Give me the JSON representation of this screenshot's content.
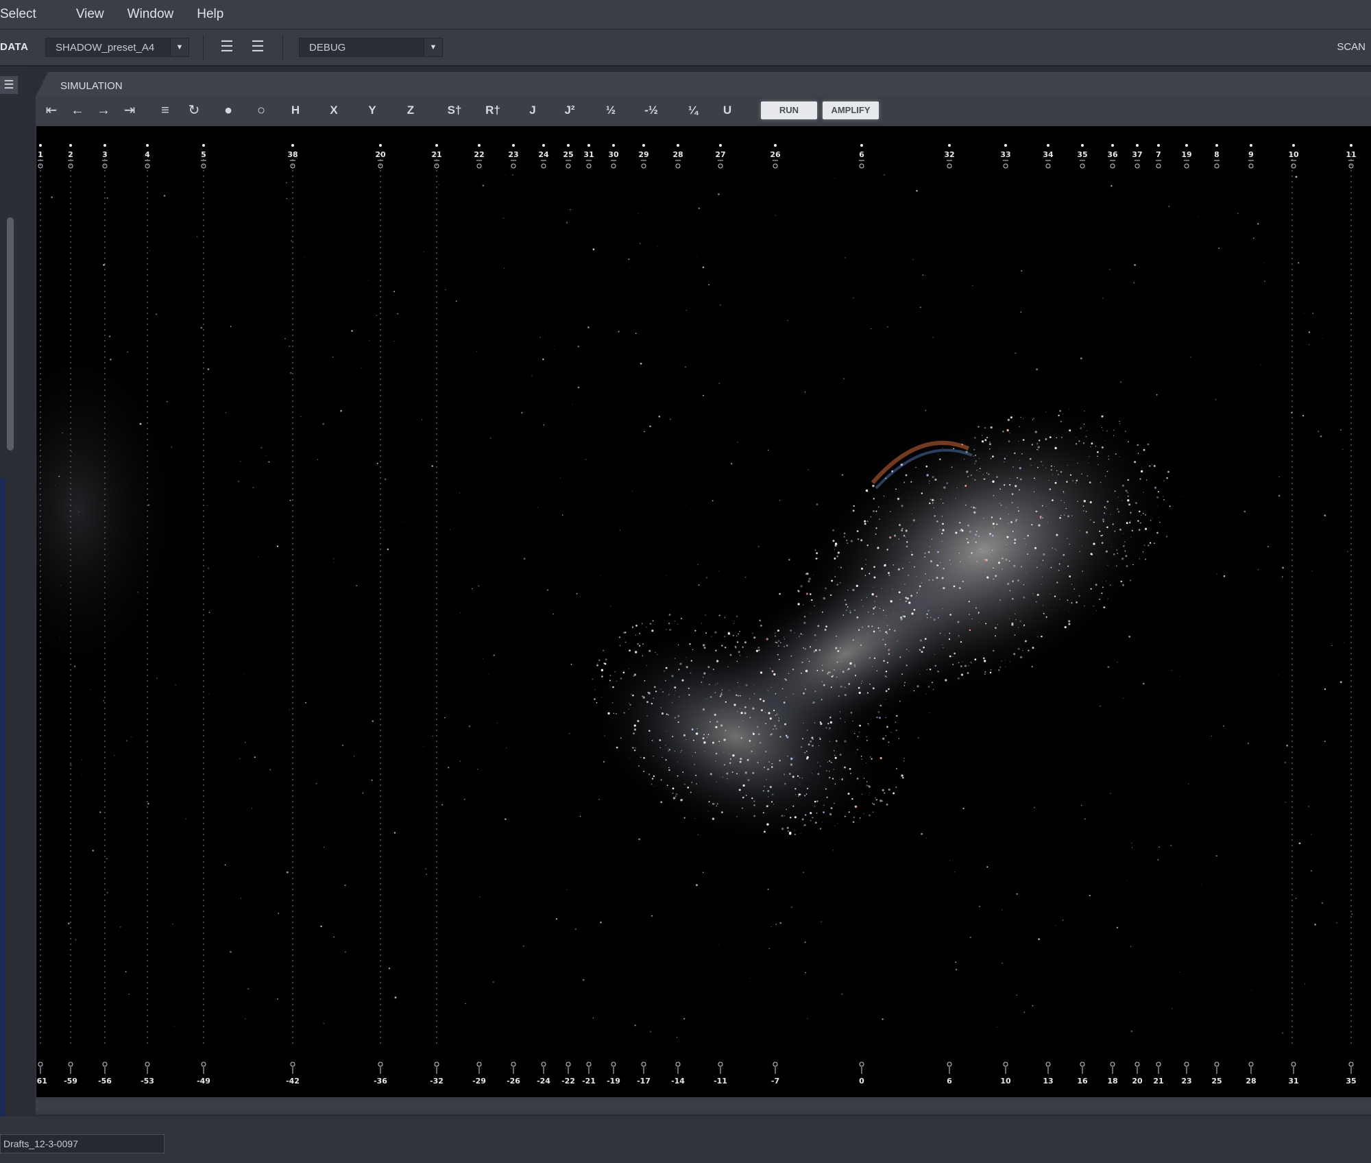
{
  "menu": [
    "Select",
    "View",
    "Window",
    "Help"
  ],
  "toolbar": {
    "data_label": "DATA",
    "preset_value": "SHADOW_preset_A4",
    "mode_value": "DEBUG",
    "scan_label": "SCAN"
  },
  "panel": {
    "tab_label": "SIMULATION",
    "buttons": {
      "h": "H",
      "x": "X",
      "y": "Y",
      "z": "Z",
      "s": "S†",
      "r": "R†",
      "j": "J",
      "j2": "J²",
      "half": "½",
      "neg_half": "-½",
      "quarter": "¼",
      "u": "U",
      "run": "RUN",
      "amplify": "AMPLIFY"
    }
  },
  "status": {
    "file_name": "Drafts_12-3-0097"
  },
  "top_ticks": [
    "1",
    "2",
    "3",
    "4",
    "5",
    "38",
    "20",
    "21",
    "22",
    "23",
    "24",
    "25",
    "31",
    "30",
    "29",
    "28",
    "27",
    "26",
    "6",
    "32",
    "33",
    "34",
    "35",
    "36",
    "37",
    "7",
    "19",
    "8",
    "9",
    "10",
    "11"
  ],
  "bottom_ticks": [
    "-61",
    "-59",
    "-56",
    "-53",
    "-49",
    "-42",
    "-36",
    "-32",
    "-29",
    "-26",
    "-24",
    "-22",
    "-21",
    "-19",
    "-17",
    "-14",
    "-11",
    "-7",
    "0",
    "6",
    "10",
    "13",
    "16",
    "18",
    "20",
    "21",
    "23",
    "25",
    "28",
    "31",
    "35"
  ],
  "icons": {
    "first": "skip-first-icon",
    "prev": "arrow-left-icon",
    "next": "arrow-right-icon",
    "last": "skip-last-icon",
    "list": "list-icon",
    "refresh": "refresh-icon",
    "filled": "filled-circle-icon",
    "hollow": "hollow-circle-icon",
    "menu": "hamburger-icon",
    "align_a": "align-lines-icon",
    "align_b": "justify-lines-icon"
  }
}
